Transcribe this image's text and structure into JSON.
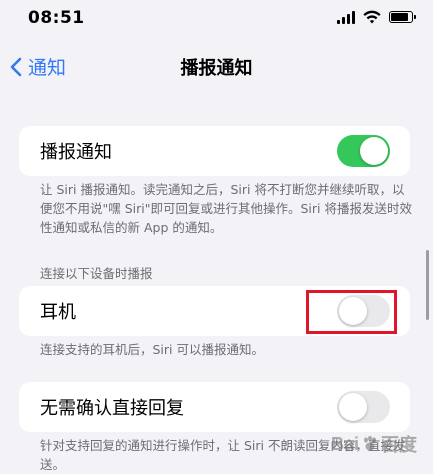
{
  "status_bar": {
    "time": "08:51"
  },
  "nav": {
    "back_label": "通知",
    "title": "播报通知"
  },
  "settings": {
    "announce": {
      "label": "播报通知",
      "enabled": true,
      "footnote": "让 Siri 播报通知。读完通知之后，Siri 将不打断您并继续听取，以便您不用说\"嘿 Siri\"即可回复或进行其他操作。Siri 将播报发送时效性通知或私信的新 App 的通知。"
    },
    "devices_section_header": "连接以下设备时播报",
    "headphones": {
      "label": "耳机",
      "enabled": false,
      "footnote": "连接支持的耳机后，Siri 可以播报通知。"
    },
    "reply_without_confirmation": {
      "label": "无需确认直接回复",
      "enabled": false,
      "footnote": "针对支持回复的通知进行操作时，让 Siri 不朗读回复内容，直接发送。"
    }
  },
  "watermark": {
    "text_left": "Bai",
    "text_right": "百度",
    "subtext": "jingyan.baidu.com"
  },
  "colors": {
    "accent": "#3478f6",
    "toggle_on": "#34c759",
    "highlight": "#e0142b"
  }
}
